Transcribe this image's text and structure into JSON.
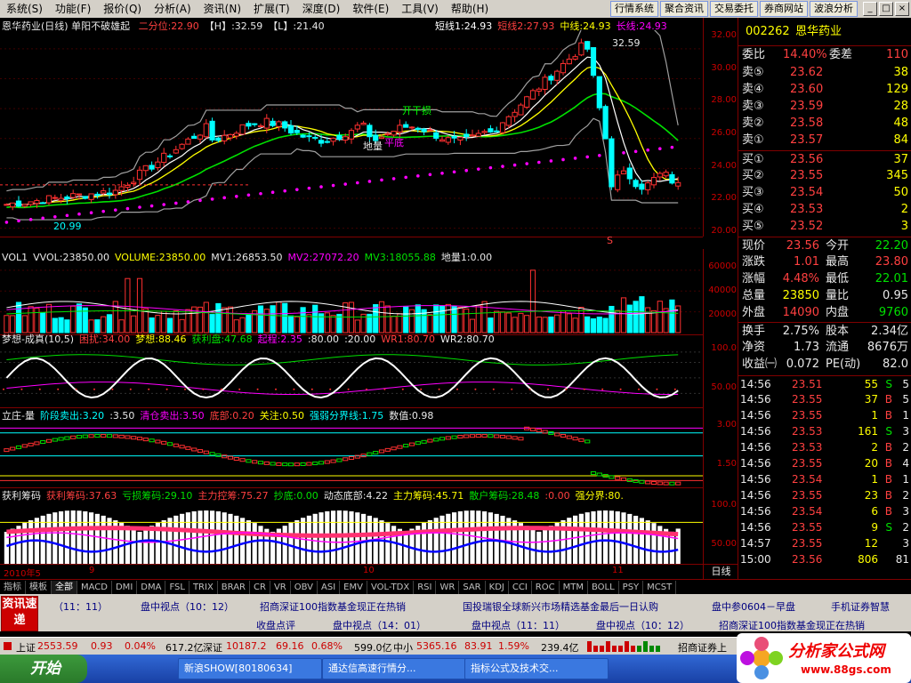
{
  "menu": [
    "系统(S)",
    "功能(F)",
    "报价(Q)",
    "分析(A)",
    "资讯(N)",
    "扩展(T)",
    "深度(D)",
    "软件(E)",
    "工具(V)",
    "帮助(H)"
  ],
  "toolbar_buttons": [
    "行情系统",
    "聚合资讯",
    "交易委托",
    "券商网站",
    "波浪分析"
  ],
  "window_controls": [
    "_",
    "□",
    "×"
  ],
  "main_panel": {
    "title": "恩华药业(日线)",
    "subtitle": "单阳不破雄起",
    "items": [
      {
        "label": "二分位:22.90",
        "color": "#ff4040"
      },
      {
        "label": "【H】:32.59",
        "color": "#e8e8e8"
      },
      {
        "label": "【L】:21.40",
        "color": "#e8e8e8"
      }
    ],
    "right_items": [
      {
        "label": "短线1:24.93",
        "color": "#ffffff"
      },
      {
        "label": "短线2:27.93",
        "color": "#ff4040"
      },
      {
        "label": "中线:24.93",
        "color": "#ffff00"
      },
      {
        "label": "长线:24.93",
        "color": "#ff00ff"
      }
    ],
    "annotations": {
      "high": "32.59",
      "low": "20.99",
      "dilong": "地量",
      "pingdi": "平底",
      "kaiqian": "开干损",
      "s_mark": "S"
    },
    "y_ticks": [
      "32.00",
      "30.00",
      "28.00",
      "26.00",
      "24.00",
      "22.00",
      "20.00"
    ]
  },
  "volume_panel": {
    "title": "VOL1",
    "items": [
      {
        "label": "VVOL:23850.00",
        "color": "#e8e8e8"
      },
      {
        "label": "VOLUME:23850.00",
        "color": "#ffff00"
      },
      {
        "label": "MV1:26853.50",
        "color": "#e8e8e8"
      },
      {
        "label": "MV2:27072.20",
        "color": "#ff00ff"
      },
      {
        "label": "MV3:18055.88",
        "color": "#00e000"
      },
      {
        "label": "地量1:0.00",
        "color": "#e8e8e8"
      }
    ],
    "y_ticks": [
      "60000",
      "40000",
      "20000"
    ]
  },
  "dream_panel": {
    "title": "梦想-成真(10,5)",
    "items": [
      {
        "label": "困扰:34.00",
        "color": "#ff4040"
      },
      {
        "label": "梦想:88.46",
        "color": "#ffff00"
      },
      {
        "label": "获利盘:47.68",
        "color": "#00e000"
      },
      {
        "label": "起程:2.35",
        "color": "#ff00ff"
      },
      {
        "label": ":80.00",
        "color": "#e8e8e8"
      },
      {
        "label": ":20.00",
        "color": "#e8e8e8"
      },
      {
        "label": "WR1:80.70",
        "color": "#ff4040"
      },
      {
        "label": "WR2:80.70",
        "color": "#e8e8e8"
      }
    ],
    "y_ticks": [
      "100.0",
      "50.00"
    ]
  },
  "lizhuang_panel": {
    "title": "立庄-量",
    "items": [
      {
        "label": "阶段卖出:3.20",
        "color": "#00ffff"
      },
      {
        "label": ":3.50",
        "color": "#e8e8e8"
      },
      {
        "label": "清仓卖出:3.50",
        "color": "#ff00ff"
      },
      {
        "label": "底部:0.20",
        "color": "#ff4040"
      },
      {
        "label": "关注:0.50",
        "color": "#ffff00"
      },
      {
        "label": "强弱分界线:1.75",
        "color": "#00ffff"
      },
      {
        "label": "数值:0.98",
        "color": "#e8e8e8"
      }
    ],
    "y_ticks": [
      "3.00",
      "1.50"
    ]
  },
  "chip_panel": {
    "title": "获利筹码",
    "items": [
      {
        "label": "获利筹码:37.63",
        "color": "#ff4040"
      },
      {
        "label": "亏损筹码:29.10",
        "color": "#00e000"
      },
      {
        "label": "主力控筹:75.27",
        "color": "#ff4040"
      },
      {
        "label": "抄底:0.00",
        "color": "#00e000"
      },
      {
        "label": "动态底部:4.22",
        "color": "#e8e8e8"
      },
      {
        "label": "主力筹码:45.71",
        "color": "#ffff00"
      },
      {
        "label": "散户筹码:28.48",
        "color": "#00e000"
      },
      {
        "label": ":0.00",
        "color": "#ff4040"
      },
      {
        "label": "强分界:80.",
        "color": "#ffff00"
      }
    ],
    "y_ticks": [
      "100.0",
      "50.00"
    ],
    "date_labels": [
      "2010年5",
      "9",
      "10",
      "11"
    ]
  },
  "period_label": "日线",
  "quote": {
    "code": "002262",
    "name": "恩华药业",
    "weibi_label": "委比",
    "weibi": "14.40%",
    "weicha_label": "委差",
    "weicha": "110",
    "asks": [
      {
        "label": "卖⑤",
        "price": "23.62",
        "vol": "38"
      },
      {
        "label": "卖④",
        "price": "23.60",
        "vol": "129"
      },
      {
        "label": "卖③",
        "price": "23.59",
        "vol": "28"
      },
      {
        "label": "卖②",
        "price": "23.58",
        "vol": "48"
      },
      {
        "label": "卖①",
        "price": "23.57",
        "vol": "84"
      }
    ],
    "bids": [
      {
        "label": "买①",
        "price": "23.56",
        "vol": "37"
      },
      {
        "label": "买②",
        "price": "23.55",
        "vol": "345"
      },
      {
        "label": "买③",
        "price": "23.54",
        "vol": "50"
      },
      {
        "label": "买④",
        "price": "23.53",
        "vol": "2"
      },
      {
        "label": "买⑤",
        "price": "23.52",
        "vol": "3"
      }
    ],
    "stats": [
      {
        "l1": "现价",
        "v1": "23.56",
        "c1": "#ff4040",
        "l2": "今开",
        "v2": "22.20",
        "c2": "#00e000"
      },
      {
        "l1": "涨跌",
        "v1": "1.01",
        "c1": "#ff4040",
        "l2": "最高",
        "v2": "23.80",
        "c2": "#ff4040"
      },
      {
        "l1": "涨幅",
        "v1": "4.48%",
        "c1": "#ff4040",
        "l2": "最低",
        "v2": "22.01",
        "c2": "#00e000"
      },
      {
        "l1": "总量",
        "v1": "23850",
        "c1": "#ffff00",
        "l2": "量比",
        "v2": "0.95",
        "c2": "#e8e8e8"
      },
      {
        "l1": "外盘",
        "v1": "14090",
        "c1": "#ff4040",
        "l2": "内盘",
        "v2": "9760",
        "c2": "#00e000"
      }
    ],
    "stats2": [
      {
        "l1": "换手",
        "v1": "2.75%",
        "c1": "#e8e8e8",
        "l2": "股本",
        "v2": "2.34亿",
        "c2": "#e8e8e8"
      },
      {
        "l1": "净资",
        "v1": "1.73",
        "c1": "#e8e8e8",
        "l2": "流通",
        "v2": "8676万",
        "c2": "#e8e8e8"
      },
      {
        "l1": "收益㈠",
        "v1": "0.072",
        "c1": "#e8e8e8",
        "l2": "PE(动)",
        "v2": "82.0",
        "c2": "#e8e8e8"
      }
    ],
    "ticks": [
      {
        "t": "14:56",
        "p": "23.51",
        "v": "55",
        "d": "S",
        "n": "5"
      },
      {
        "t": "14:56",
        "p": "23.55",
        "v": "37",
        "d": "B",
        "n": "5"
      },
      {
        "t": "14:56",
        "p": "23.55",
        "v": "1",
        "d": "B",
        "n": "1"
      },
      {
        "t": "14:56",
        "p": "23.53",
        "v": "161",
        "d": "S",
        "n": "3"
      },
      {
        "t": "14:56",
        "p": "23.53",
        "v": "2",
        "d": "B",
        "n": "2"
      },
      {
        "t": "14:56",
        "p": "23.55",
        "v": "20",
        "d": "B",
        "n": "4"
      },
      {
        "t": "14:56",
        "p": "23.54",
        "v": "1",
        "d": "B",
        "n": "1"
      },
      {
        "t": "14:56",
        "p": "23.55",
        "v": "23",
        "d": "B",
        "n": "2"
      },
      {
        "t": "14:56",
        "p": "23.54",
        "v": "6",
        "d": "B",
        "n": "3"
      },
      {
        "t": "14:56",
        "p": "23.55",
        "v": "9",
        "d": "S",
        "n": "2"
      },
      {
        "t": "14:57",
        "p": "23.55",
        "v": "12",
        "d": "",
        "n": "3"
      },
      {
        "t": "15:00",
        "p": "23.56",
        "v": "806",
        "d": "",
        "n": "81"
      }
    ],
    "bottom_tabs": [
      "笔",
      "价",
      "细",
      "盘",
      "势",
      "指",
      "值",
      "筹"
    ]
  },
  "indicator_tabs": [
    "指标",
    "模板",
    "全部",
    "MACD",
    "DMI",
    "DMA",
    "FSL",
    "TRIX",
    "BRAR",
    "CR",
    "VR",
    "OBV",
    "ASI",
    "EMV",
    "VOL-TDX",
    "RSI",
    "WR",
    "SAR",
    "KDJ",
    "CCI",
    "ROC",
    "MTM",
    "BOLL",
    "PSY",
    "MCST"
  ],
  "news": {
    "logo": "资讯速递",
    "row1": [
      "（11：11）",
      "盘中视点（10：12）",
      "招商深证100指数基金现正在热销",
      "国投瑞银全球新兴市场精选基金最后一日认购",
      "盘中参0604－早盘",
      "手机证券智慧"
    ],
    "row2": [
      "收盘点评",
      "盘中视点（14：01）",
      "盘中视点（11：11）",
      "盘中视点（10：12）",
      "招商深证100指数基金现正在热销"
    ]
  },
  "status": {
    "sh_label": "上证",
    "sh_val": "2553.59",
    "sh_chg": "0.93",
    "sh_pct": "0.04%",
    "sh_amt": "617.2亿",
    "sz_label": "深证",
    "sz_val": "10187.2",
    "sz_chg": "69.16",
    "sz_pct": "0.68%",
    "sz_amt": "599.0亿",
    "zx_label": "中小",
    "zx_val": "5365.16",
    "zx_chg": "83.91",
    "zx_pct": "1.59%",
    "zx_amt": "239.4亿",
    "broker": "招商证券上"
  },
  "taskbar": {
    "start": "开始",
    "tasks": [
      "新浪SHOW[80180634]",
      "通达信高速行情分...",
      "指标公式及技术交..."
    ]
  },
  "watermark": {
    "title": "分析家公式网",
    "url": "www.88gs.com"
  },
  "colors": {
    "up": "#ff4040",
    "down": "#00e000",
    "frame": "#800000"
  }
}
